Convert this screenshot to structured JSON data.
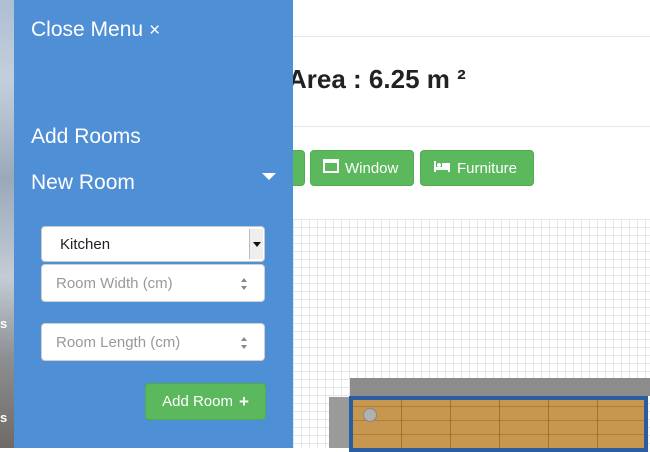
{
  "background": {
    "strip_chars": [
      "s",
      "s"
    ]
  },
  "main": {
    "area_title": "Area : 6.25 m ²",
    "toolbar": {
      "window_label": "Window",
      "furniture_label": "Furniture"
    }
  },
  "sidebar": {
    "close_label": "Close Menu",
    "close_icon": "×",
    "add_rooms_label": "Add Rooms",
    "new_room_label": "New Room",
    "room_type": {
      "selected": "Kitchen"
    },
    "width_input": {
      "placeholder": "Room Width (cm)",
      "value": ""
    },
    "length_input": {
      "placeholder": "Room Length (cm)",
      "value": ""
    },
    "add_room_label": "Add Room",
    "add_room_icon": "+"
  },
  "colors": {
    "sidebar_bg": "#4f8fd6",
    "success_green": "#5cb85c",
    "room_wall_blue": "#2a5d9f",
    "floor_wood": "#c7964f"
  }
}
